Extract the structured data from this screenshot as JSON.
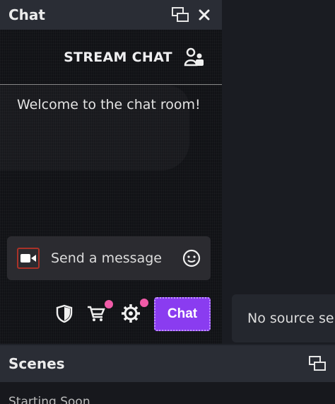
{
  "chat_dock": {
    "title": "Chat",
    "header": "STREAM CHAT",
    "welcome": "Welcome to the chat room!",
    "input_placeholder": "Send a message",
    "send_label": "Chat"
  },
  "preview": {
    "no_source_text": "No source sele"
  },
  "scenes_dock": {
    "title": "Scenes",
    "items": [
      "Starting Soon"
    ]
  },
  "colors": {
    "accent": "#8a3cf0",
    "notification_dot": "#f05ba8",
    "video_icon_border": "#a93228"
  }
}
